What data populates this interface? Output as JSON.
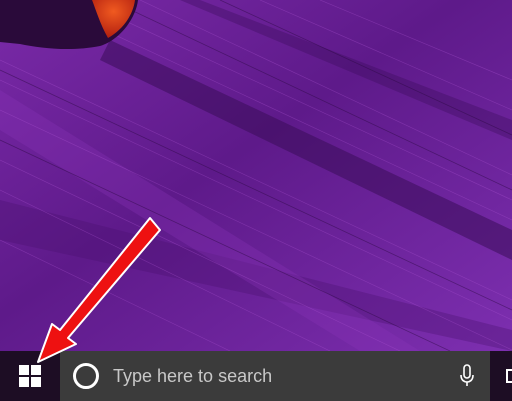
{
  "desktop": {
    "wallpaper_colors": {
      "base": "#5e1a8a",
      "highlight": "#9b3cc4",
      "shadow": "#2d0a45",
      "rock_orange": "#e0401a"
    }
  },
  "taskbar": {
    "background": "#1d0d24",
    "start_icon": "windows-logo-icon",
    "search": {
      "placeholder": "Type here to search",
      "left_icon": "cortana-circle-icon",
      "right_icon": "microphone-icon",
      "background": "#3b3b3b"
    },
    "task_view_icon": "task-view-icon"
  },
  "annotation": {
    "arrow_color": "#ee1111",
    "arrow_target": "start-button"
  }
}
